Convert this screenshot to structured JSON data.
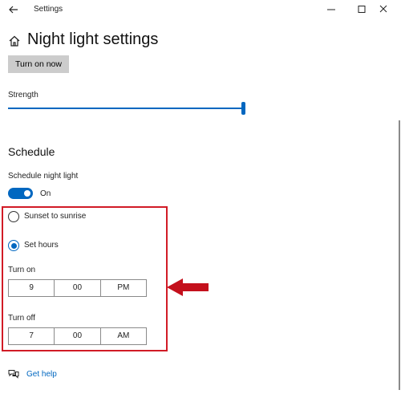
{
  "window": {
    "title": "Settings",
    "controls": {
      "minimize": "minimize-icon",
      "maximize": "maximize-icon",
      "close": "close-icon"
    }
  },
  "header": {
    "title": "Night light settings",
    "icon": "home-icon"
  },
  "turn_on_button": "Turn on now",
  "strength": {
    "label": "Strength",
    "value_fraction": 1.0
  },
  "schedule": {
    "heading": "Schedule",
    "toggle_label": "Schedule night light",
    "toggle_state": "On",
    "options": [
      {
        "label": "Sunset to sunrise",
        "selected": false
      },
      {
        "label": "Set hours",
        "selected": true
      }
    ],
    "turn_on": {
      "label": "Turn on",
      "hour": "9",
      "minute": "00",
      "period": "PM"
    },
    "turn_off": {
      "label": "Turn off",
      "hour": "7",
      "minute": "00",
      "period": "AM"
    }
  },
  "help": {
    "label": "Get help",
    "icon": "help-chat-icon"
  },
  "colors": {
    "accent": "#0067c0",
    "highlight": "#d11b26",
    "button_bg": "#cccccc"
  }
}
